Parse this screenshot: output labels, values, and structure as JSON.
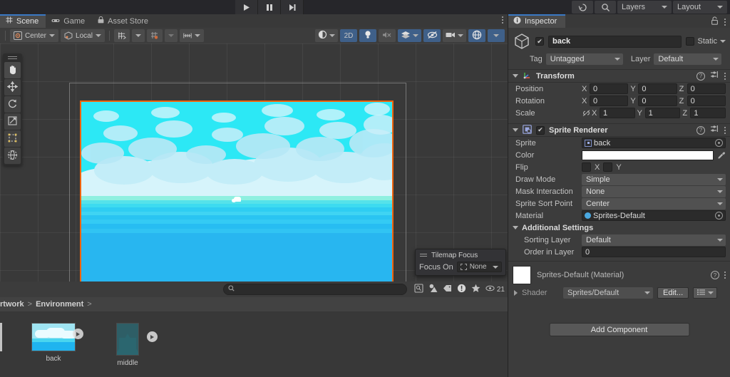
{
  "topbar": {
    "play_label": "play-icon",
    "pause_label": "pause-icon",
    "step_label": "step-icon",
    "history_icon": "history-icon",
    "search_icon": "search-icon",
    "layers_label": "Layers",
    "layout_label": "Layout"
  },
  "scene_panel": {
    "tabs": [
      {
        "label": "Scene",
        "icon": "grid-icon",
        "active": true
      },
      {
        "label": "Game",
        "icon": "gamepad-icon",
        "active": false
      },
      {
        "label": "Asset Store",
        "icon": "store-icon",
        "active": false
      }
    ],
    "toolbar": {
      "pivot_label": "Center",
      "handle_label": "Local",
      "grid_snap_icon": "grid-snap-icon",
      "snap_increment_icon": "snap-increment-icon",
      "grid_size_icon": "grid-size-icon"
    },
    "view_toolbar": {
      "shading_label": "shading-mode-icon",
      "mode_2d_label": "2D",
      "lighting_icon": "light-bulb-icon",
      "audio_icon": "audio-mute-icon",
      "effects_icon": "effects-icon",
      "hidden_icon": "hidden-objects-icon",
      "camera_icon": "scene-camera-icon",
      "gizmos_icon": "gizmos-icon"
    },
    "tools": [
      {
        "name": "hand-tool",
        "glyph": "hand-icon"
      },
      {
        "name": "move-tool",
        "glyph": "move-icon"
      },
      {
        "name": "rotate-tool",
        "glyph": "rotate-icon"
      },
      {
        "name": "scale-tool",
        "glyph": "scale-icon"
      },
      {
        "name": "rect-tool",
        "glyph": "rect-icon"
      },
      {
        "name": "transform-tool",
        "glyph": "transform-icon"
      }
    ],
    "tilemap_focus": {
      "title": "Tilemap Focus",
      "field_label": "Focus On",
      "value": "None"
    }
  },
  "project_panel": {
    "search_placeholder": "",
    "search_value": "",
    "breadcrumb": [
      "rtwork",
      "Environment",
      ""
    ],
    "filter_icons": [
      "search-save-icon",
      "prefab-filter-icon",
      "label-filter-icon",
      "warning-filter-icon",
      "favorite-filter-icon"
    ],
    "visible_count": "21",
    "assets": [
      {
        "label": "back",
        "kind": "sprite-sheet"
      },
      {
        "label": "middle",
        "kind": "sprite-sheet"
      }
    ]
  },
  "inspector": {
    "tab_label": "Inspector",
    "lock_icon": "lock-icon",
    "menu_icon": "kebab-menu-icon",
    "object": {
      "enabled": true,
      "name": "back",
      "static_label": "Static",
      "static_checked": false,
      "tag_label": "Tag",
      "tag_value": "Untagged",
      "layer_label": "Layer",
      "layer_value": "Default"
    },
    "transform": {
      "title": "Transform",
      "rows": [
        {
          "name": "Position",
          "x": "0",
          "y": "0",
          "z": "0"
        },
        {
          "name": "Rotation",
          "x": "0",
          "y": "0",
          "z": "0"
        },
        {
          "name": "Scale",
          "x": "1",
          "y": "1",
          "z": "1"
        }
      ],
      "axis_labels": [
        "X",
        "Y",
        "Z"
      ],
      "scale_link_icon": "broken-link-icon"
    },
    "sprite_renderer": {
      "title": "Sprite Renderer",
      "enabled": true,
      "sprite_label": "Sprite",
      "sprite_value": "back",
      "color_label": "Color",
      "color_value": "#FFFFFF",
      "flip_label": "Flip",
      "flip_x_label": "X",
      "flip_y_label": "Y",
      "draw_mode_label": "Draw Mode",
      "draw_mode_value": "Simple",
      "mask_label": "Mask Interaction",
      "mask_value": "None",
      "sort_point_label": "Sprite Sort Point",
      "sort_point_value": "Center",
      "material_label": "Material",
      "material_value": "Sprites-Default",
      "additional_settings_label": "Additional Settings",
      "sorting_layer_label": "Sorting Layer",
      "sorting_layer_value": "Default",
      "order_label": "Order in Layer",
      "order_value": "0"
    },
    "material": {
      "title": "Sprites-Default (Material)",
      "shader_label": "Shader",
      "shader_value": "Sprites/Default",
      "edit_label": "Edit..."
    },
    "add_component_label": "Add Component"
  },
  "colors": {
    "accent_blue": "#3a79c4",
    "selection_orange": "#f0630d",
    "panel_bg": "#3c3c3c",
    "scene_bg": "#393939",
    "sky": "#2ce8f5",
    "sea": "#28b6f0"
  }
}
